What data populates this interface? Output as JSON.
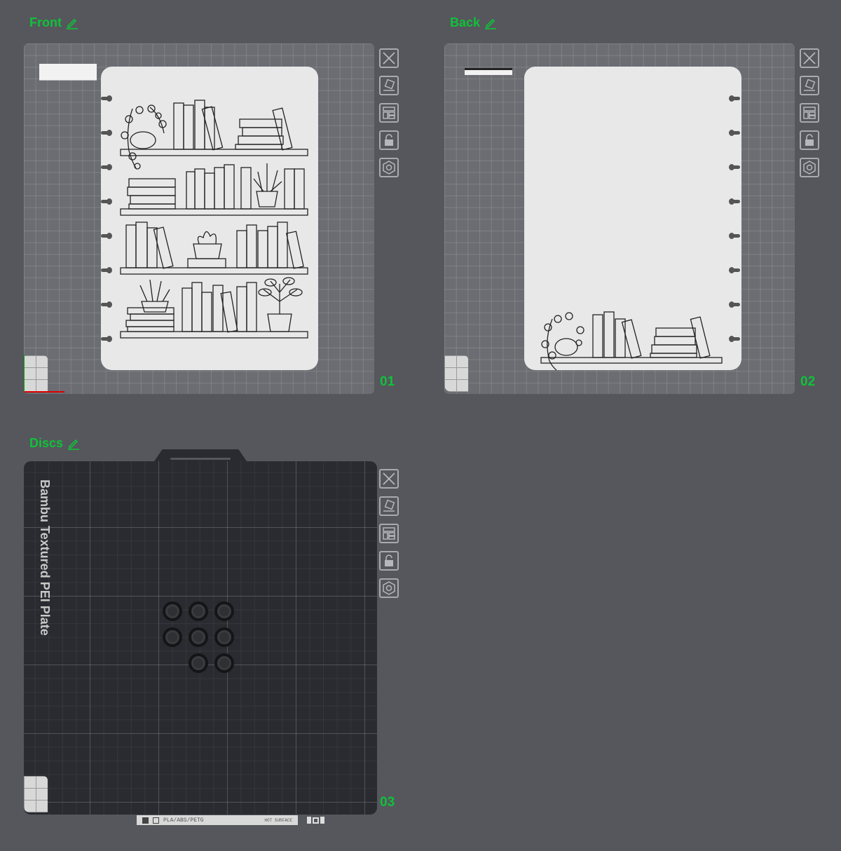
{
  "plates": [
    {
      "name": "Front",
      "number": "01"
    },
    {
      "name": "Back",
      "number": "02"
    },
    {
      "name": "Discs",
      "number": "03"
    }
  ],
  "bed_label": "Bambu Textured PEI Plate",
  "footer": {
    "materials": "PLA/ABS/PETG",
    "warning": "HOT SURFACE"
  },
  "toolbar": [
    "close-icon",
    "auto-orient-icon",
    "arrange-icon",
    "lock-icon",
    "settings-icon"
  ],
  "colors": {
    "accent": "#10c13a",
    "background": "#55575c",
    "bed_light": "#6b6d72",
    "bed_dark": "#2a2b30"
  }
}
